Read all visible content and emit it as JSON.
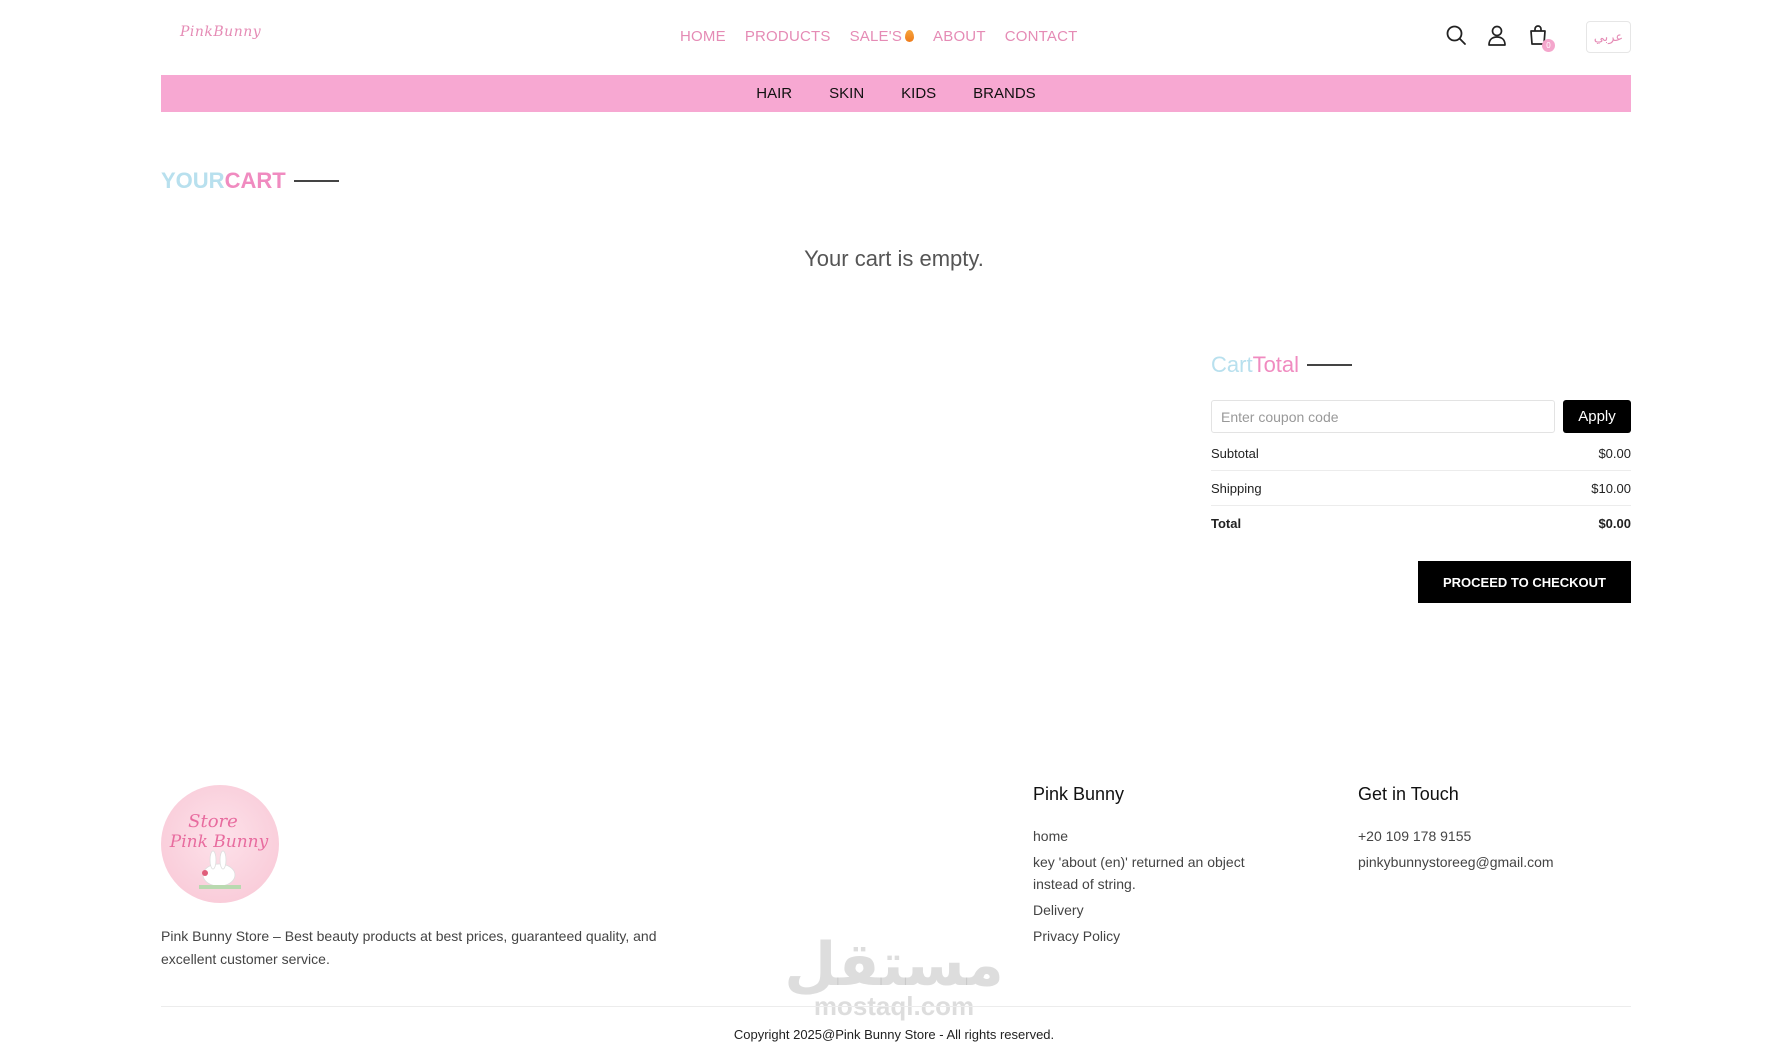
{
  "header": {
    "logo_text": "PinkBunny",
    "nav": [
      {
        "label": "HOME"
      },
      {
        "label": "PRODUCTS"
      },
      {
        "label": "SALE'S"
      },
      {
        "label": "ABOUT"
      },
      {
        "label": "CONTACT"
      }
    ],
    "icons": [
      "search-icon",
      "user-icon",
      "cart-icon"
    ],
    "cart_count": "0",
    "lang_label": "عربي"
  },
  "categories": [
    {
      "label": "HAIR"
    },
    {
      "label": "SKIN"
    },
    {
      "label": "KIDS"
    },
    {
      "label": "BRANDS"
    }
  ],
  "cart": {
    "title_part1": "YOUR",
    "title_part2": "CART",
    "empty_message": "Your cart is empty."
  },
  "cart_total": {
    "title_part1": "Cart",
    "title_part2": "Total",
    "coupon_placeholder": "Enter coupon code",
    "apply_label": "Apply",
    "rows": [
      {
        "label": "Subtotal",
        "value": "$0.00"
      },
      {
        "label": "Shipping",
        "value": "$10.00"
      },
      {
        "label": "Total",
        "value": "$0.00"
      }
    ],
    "checkout_label": "PROCEED TO CHECKOUT"
  },
  "footer": {
    "logo_text_1": "Store",
    "logo_text_2": "Pink Bunny",
    "description": "Pink Bunny Store – Best beauty products at best prices, guaranteed quality, and excellent customer service.",
    "col1": {
      "title": "Pink Bunny",
      "links": [
        "home",
        "key 'about (en)' returned an object instead of string.",
        "Delivery",
        "Privacy Policy"
      ]
    },
    "col2": {
      "title": "Get in Touch",
      "items": [
        "+20 109 178 9155",
        "pinkybunnystoreeg@gmail.com"
      ]
    },
    "copyright": "Copyright 2025@Pink Bunny Store - All rights reserved."
  },
  "watermark": {
    "arabic": "مستقل",
    "latin": "mostaql.com"
  },
  "colors": {
    "accent_pink": "#f08bc0",
    "category_bar": "#f7a8d2",
    "light_blue": "#b8e0ee",
    "button_black": "#000000"
  }
}
